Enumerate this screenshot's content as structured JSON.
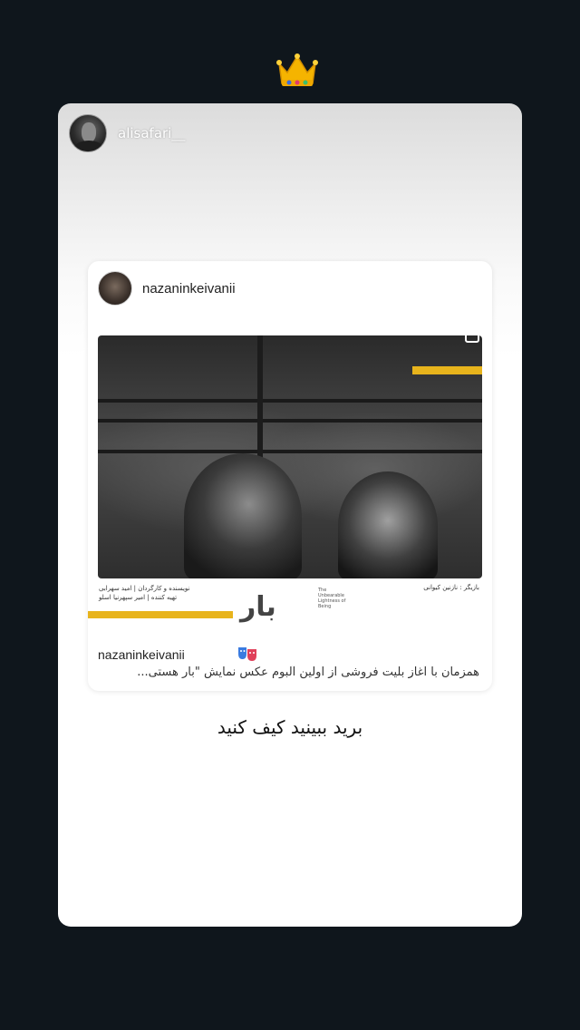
{
  "story": {
    "username": "alisafari__",
    "text": "برید ببینید کیف کنید"
  },
  "sticker": {
    "icon": "crown-icon"
  },
  "post": {
    "username": "nazaninkeivanii",
    "image": {
      "film_title_fa": "بار هستی",
      "film_title_en": "The Unbearable Lightness of Being",
      "credit_left_line1": "نویسنده و کارگردان | امید سهرابی",
      "credit_left_line2": "تهیه کننده | امیر سپهرنیا اسلو",
      "credit_right": "بازیگر : نازنین کیوانی"
    },
    "caption_user": "nazaninkeivanii",
    "caption_emoji": "theater-masks-icon",
    "caption_text": "همزمان با آغاز بلیت فروشی از اولین آلبوم عکس نمایش \"بار هستی..."
  },
  "colors": {
    "background": "#0f161c",
    "accent_yellow": "#e8b41c"
  }
}
